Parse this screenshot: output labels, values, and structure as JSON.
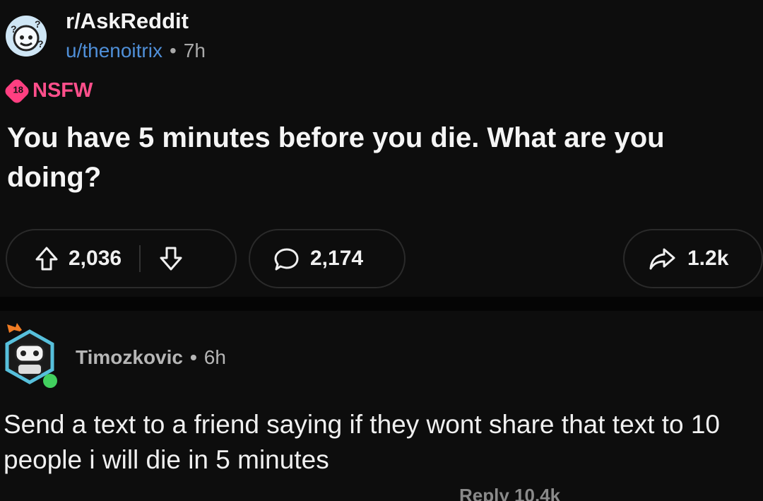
{
  "post": {
    "subreddit": "r/AskReddit",
    "username": "u/thenoitrix",
    "separator": "•",
    "age": "7h",
    "nsfw_badge": "18",
    "nsfw_label": "NSFW",
    "title": "You have 5 minutes before you die. What are you doing?",
    "actions": {
      "upvotes": "2,036",
      "comments": "2,174",
      "shares": "1.2k"
    }
  },
  "comment": {
    "author": "Timozkovic",
    "separator": "•",
    "age": "6h",
    "text": "Send a text to a friend saying if they wont share that text to 10 people i will die in 5 minutes",
    "partial_actions": "Reply 10.4k"
  },
  "icons": {
    "upvote": "arrow-up-icon",
    "downvote": "arrow-down-icon",
    "comment": "comment-bubble-icon",
    "share": "share-arrow-icon"
  },
  "colors": {
    "background": "#0b0b0b",
    "username": "#4f8fd8",
    "nsfw": "#ff4f8b"
  }
}
